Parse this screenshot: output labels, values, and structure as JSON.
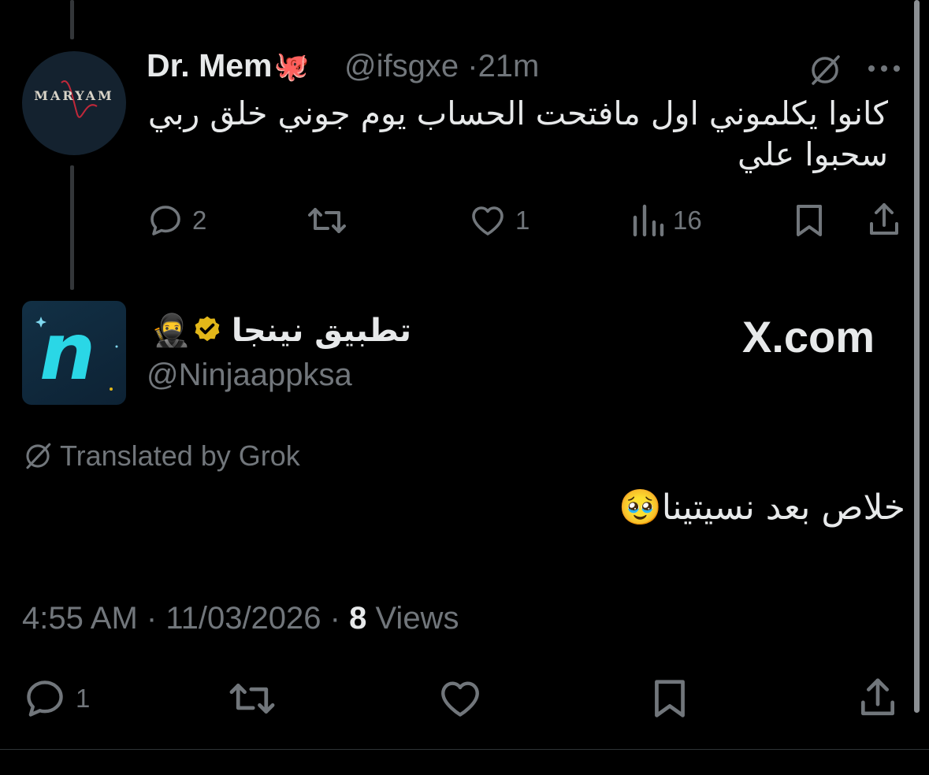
{
  "tweet1": {
    "display_name": "Dr. Mem",
    "name_emoji": "🐙",
    "handle": "@ifsgxe",
    "time": "21m",
    "avatar_text": "MARYAM",
    "text": "كانوا يكلموني اول مافتحت الحساب يوم جوني خلق ربي سحبوا علي",
    "actions": {
      "replies": "2",
      "retweets": "",
      "likes": "1",
      "views": "16"
    }
  },
  "tweet2": {
    "display_name": "تطبيق نينجا",
    "name_emoji": "🥷",
    "handle": "@Ninjaappksa",
    "source": "X.com",
    "translated_label": "Translated by Grok",
    "text": "خلاص بعد نسيتينا",
    "text_emoji": "🥹",
    "time": "4:55 AM",
    "date": "11/03/2026",
    "views_count": "8",
    "views_label": "Views",
    "actions": {
      "replies": "1"
    }
  },
  "colors": {
    "background": "#000000",
    "text": "#e7e9ea",
    "muted": "#71767b",
    "verified": "#e2b719",
    "avatar_accent": "#2ad7e6"
  },
  "icons": [
    "grok-icon",
    "more-icon",
    "reply-icon",
    "retweet-icon",
    "like-icon",
    "views-icon",
    "bookmark-icon",
    "share-icon",
    "verified-badge-icon"
  ]
}
